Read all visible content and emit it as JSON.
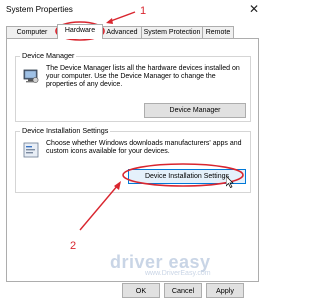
{
  "window": {
    "title": "System Properties"
  },
  "tabs": [
    {
      "label": "Computer Name"
    },
    {
      "label": "Hardware"
    },
    {
      "label": "Advanced"
    },
    {
      "label": "System Protection"
    },
    {
      "label": "Remote"
    }
  ],
  "device_manager": {
    "group_title": "Device Manager",
    "description": "The Device Manager lists all the hardware devices installed on your computer. Use the Device Manager to change the properties of any device.",
    "button_label": "Device Manager"
  },
  "device_installation": {
    "group_title": "Device Installation Settings",
    "description": "Choose whether Windows downloads manufacturers' apps and custom icons available for your devices.",
    "button_label": "Device Installation Settings"
  },
  "footer": {
    "ok": "OK",
    "cancel": "Cancel",
    "apply": "Apply"
  },
  "annotations": {
    "step1": "1",
    "step2": "2",
    "color": "#d9262f"
  },
  "watermark": {
    "text": "driver easy",
    "url_text": "www.DriverEasy.com"
  }
}
